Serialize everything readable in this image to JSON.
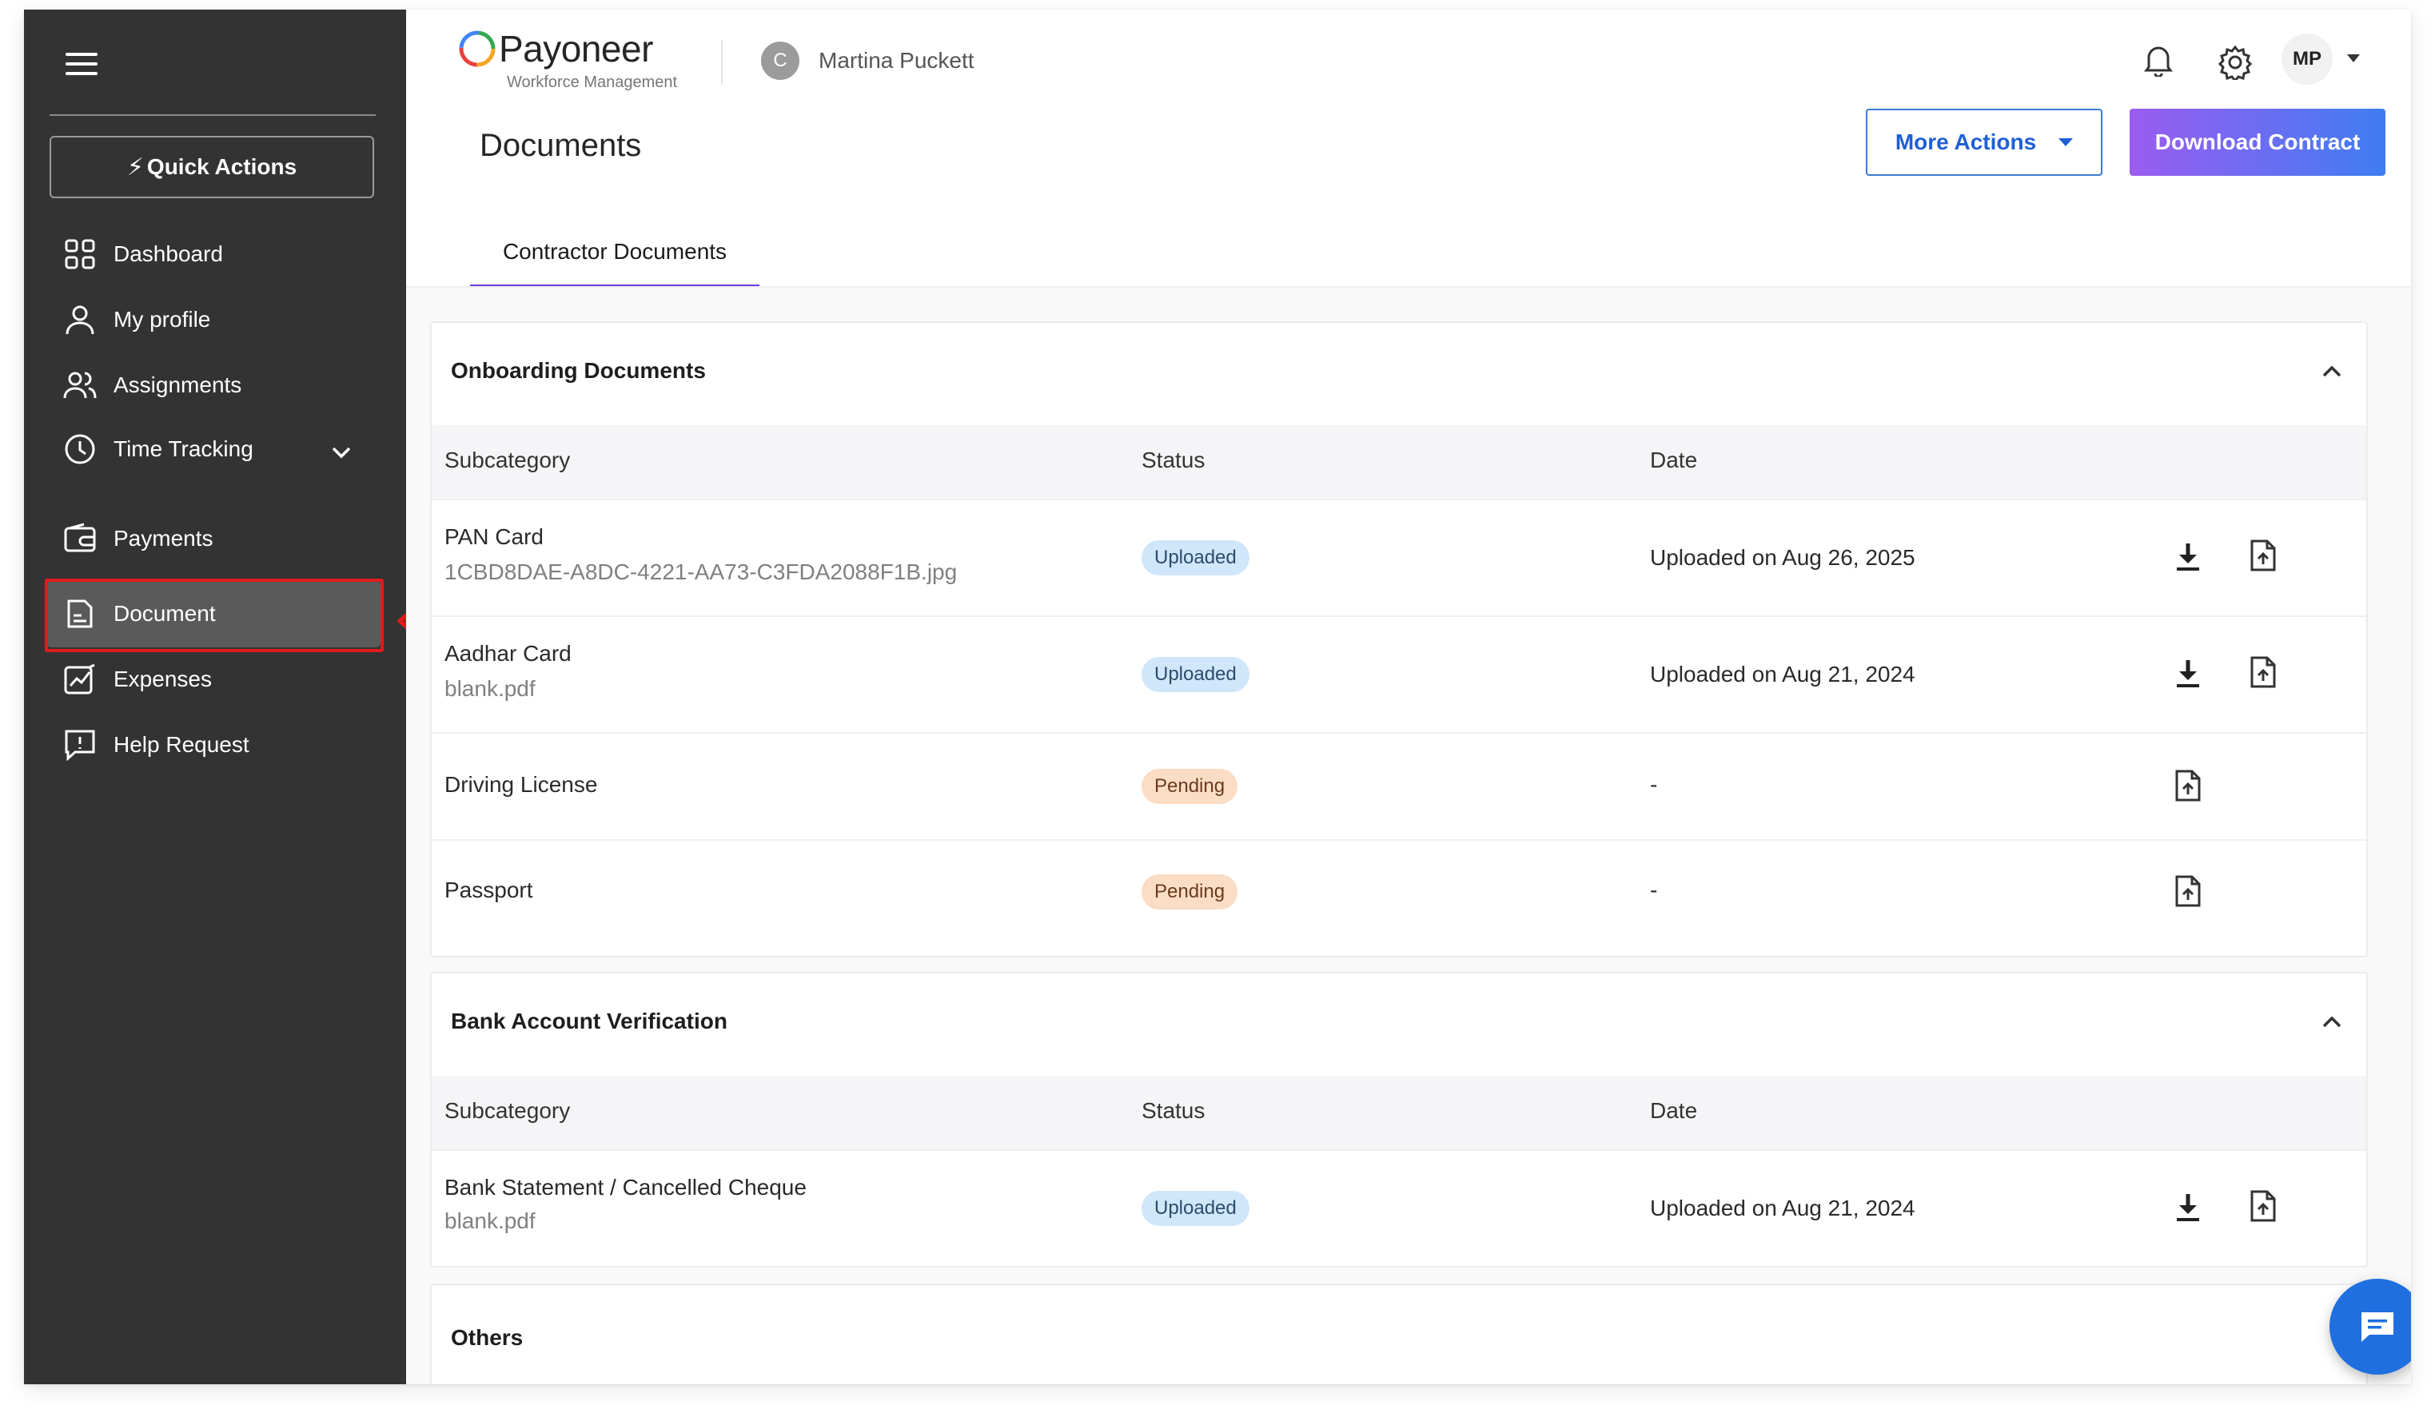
{
  "sidebar": {
    "quick_actions": "Quick Actions",
    "items": [
      {
        "label": "Dashboard"
      },
      {
        "label": "My profile"
      },
      {
        "label": "Assignments"
      },
      {
        "label": "Time Tracking"
      },
      {
        "label": "Payments"
      },
      {
        "label": "Document"
      },
      {
        "label": "Expenses"
      },
      {
        "label": "Help Request"
      }
    ],
    "active_item": "Document"
  },
  "header": {
    "brand": "Payoneer",
    "brand_sub": "Workforce Management",
    "user_initial": "C",
    "user_name": "Martina Puckett",
    "avatar_initials": "MP"
  },
  "page": {
    "title": "Documents",
    "more_actions": "More Actions",
    "download_contract": "Download Contract",
    "tab": "Contractor Documents"
  },
  "table_headers": {
    "subcategory": "Subcategory",
    "status": "Status",
    "date": "Date"
  },
  "sections": [
    {
      "title": "Onboarding Documents",
      "rows": [
        {
          "name": "PAN Card",
          "file": "1CBD8DAE-A8DC-4221-AA73-C3FDA2088F1B.jpg",
          "status": "Uploaded",
          "date": "Uploaded on Aug 26, 2025"
        },
        {
          "name": "Aadhar Card",
          "file": "blank.pdf",
          "status": "Uploaded",
          "date": "Uploaded on Aug 21, 2024"
        },
        {
          "name": "Driving License",
          "file": "",
          "status": "Pending",
          "date": "-"
        },
        {
          "name": "Passport",
          "file": "",
          "status": "Pending",
          "date": "-"
        }
      ]
    },
    {
      "title": "Bank Account Verification",
      "rows": [
        {
          "name": "Bank Statement / Cancelled Cheque",
          "file": "blank.pdf",
          "status": "Uploaded",
          "date": "Uploaded on Aug 21, 2024"
        }
      ]
    },
    {
      "title": "Others",
      "rows": []
    }
  ],
  "colors": {
    "sidebar_bg": "#333333",
    "accent_purple": "#6a3ce0",
    "link_blue": "#1f5fd6",
    "uploaded_badge": "#cfe6fb",
    "pending_badge": "#fbdcc4",
    "highlight_red": "#e01b1b"
  }
}
